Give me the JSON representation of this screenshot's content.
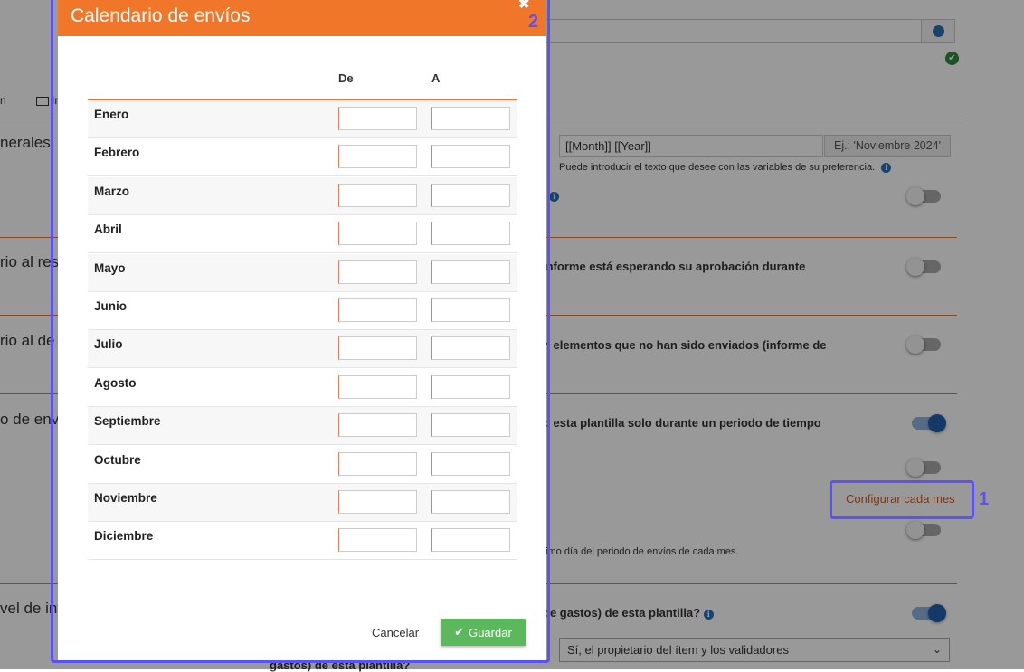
{
  "background": {
    "tabs": [
      "n",
      "In"
    ],
    "sections": [
      "nerales",
      "rio al res",
      "rio al de",
      "o de envío",
      "vel de int"
    ],
    "subject_input": {
      "value": "[[Month]] [[Year]]",
      "example": "Ej.: 'Noviembre 2024'"
    },
    "subject_help": "Puede introducir el texto que desee con las variables de su preferencia.",
    "row_texts": [
      "l",
      "informe está esperando su aprobación durante",
      "n elementos que no han sido enviados (informe de",
      "d esta plantilla solo durante un periodo de tiempo",
      "de gastos) de esta plantilla?"
    ],
    "config_link": "Configurar cada mes",
    "period_note": "timo día del periodo de envíos de cada mes.",
    "select_value": "Sí, el propietario del ítem y los validadores",
    "bottom_text": "gastos) de esta plantilla?",
    "toggles": [
      false,
      false,
      false,
      true,
      false,
      false,
      true
    ]
  },
  "modal": {
    "title": "Calendario de envíos",
    "close_symbol": "✖",
    "col_from": "De",
    "col_to": "A",
    "months": [
      "Enero",
      "Febrero",
      "Marzo",
      "Abril",
      "Mayo",
      "Junio",
      "Julio",
      "Agosto",
      "Septiembre",
      "Octubre",
      "Noviembre",
      "Diciembre"
    ],
    "cancel_label": "Cancelar",
    "save_label": "Guardar"
  },
  "annotations": {
    "first": "1",
    "second": "2"
  },
  "colors": {
    "accent": "#f0772a",
    "save": "#5cb85c",
    "annotation": "#5b52f0",
    "toggle_on": "#1f5fad"
  }
}
